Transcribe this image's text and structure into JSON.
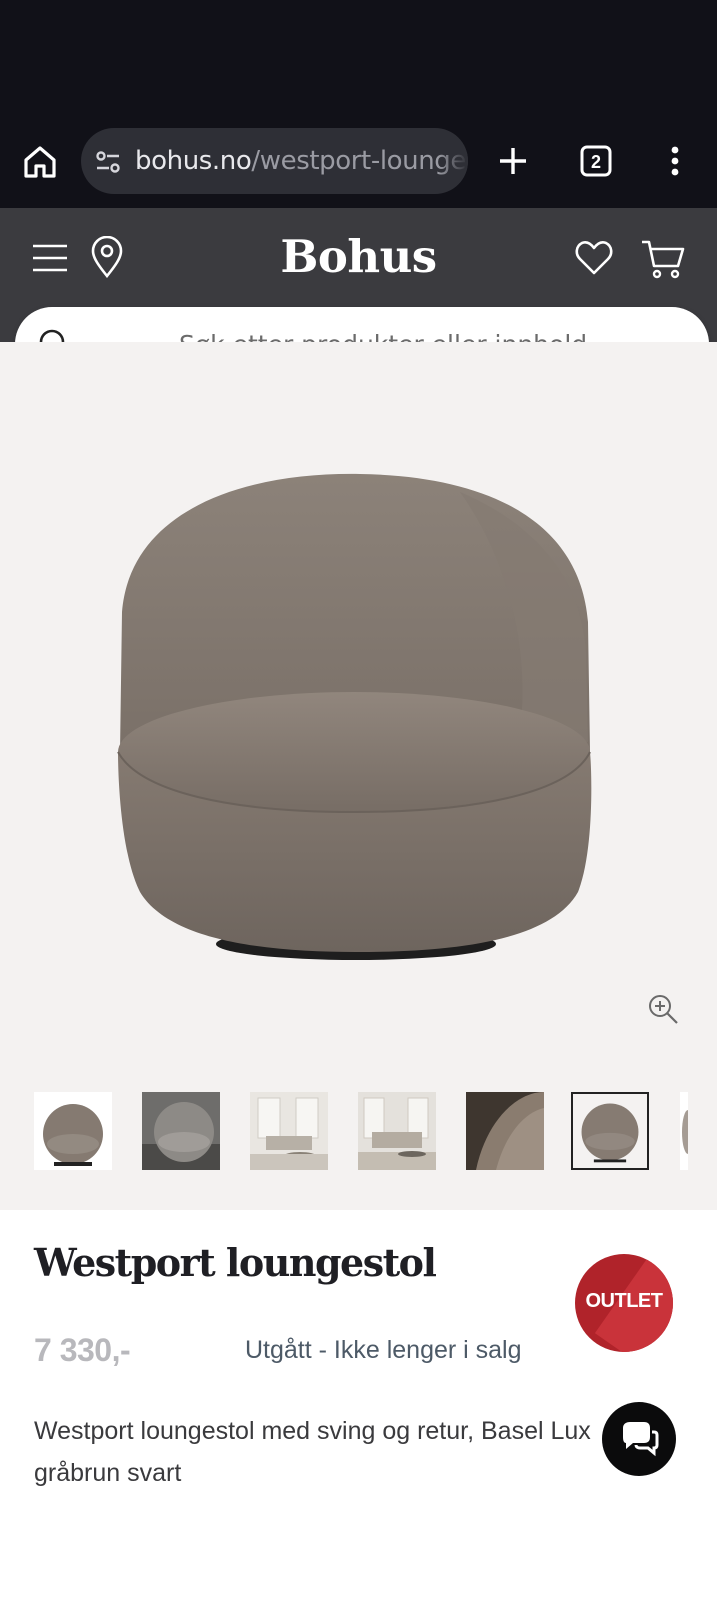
{
  "browser": {
    "url_domain": "bohus.no",
    "url_path": "/westport-lounge",
    "tab_count": "2",
    "icons": [
      "home-icon",
      "site-settings-icon",
      "plus-icon",
      "tabs-icon",
      "more-vert-icon"
    ]
  },
  "header": {
    "logo": "Bohus",
    "icons": [
      "menu-icon",
      "location-pin-icon",
      "heart-icon",
      "cart-icon"
    ],
    "background": "#3b3b3f"
  },
  "search": {
    "placeholder": "Søk etter produkter eller innhold..."
  },
  "gallery": {
    "thumbnail_count": 7,
    "active_thumbnail_index": 5,
    "background": "#f4f2f1"
  },
  "product": {
    "title": "Westport loungestol",
    "badge": "OUTLET",
    "badge_color": "#b0232a",
    "price": "7 330,-",
    "availability": "Utgått - Ikke lenger i salg",
    "description": "Westport loungestol med sving og retur, Basel Lux gråbrun svart"
  }
}
